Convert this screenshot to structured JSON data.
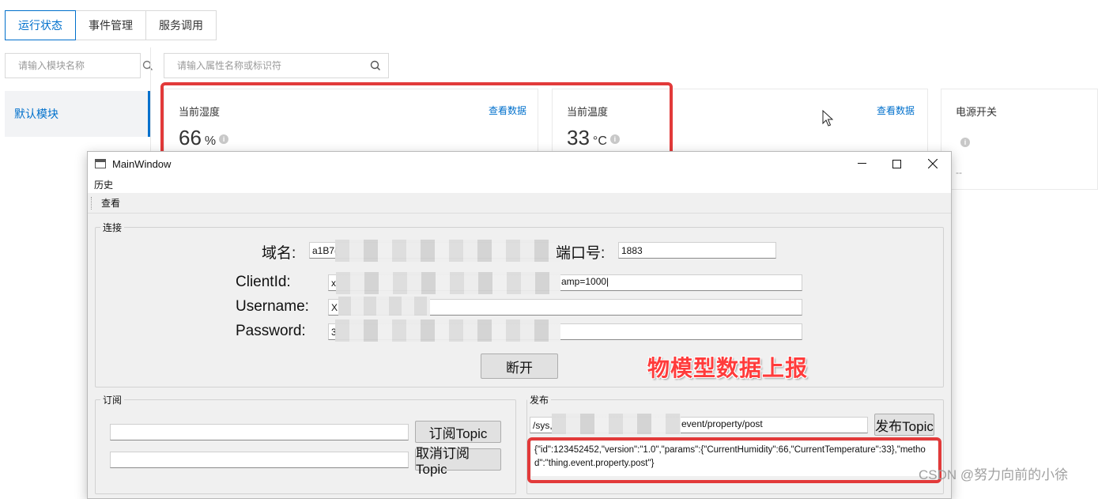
{
  "console": {
    "tabs": [
      {
        "label": "运行状态",
        "active": true
      },
      {
        "label": "事件管理",
        "active": false
      },
      {
        "label": "服务调用",
        "active": false
      }
    ],
    "module_search": {
      "placeholder": "请输入模块名称"
    },
    "property_search": {
      "placeholder": "请输入属性名称或标识符"
    },
    "module_nav": {
      "label": "默认模块"
    },
    "cards": [
      {
        "title": "当前湿度",
        "link": "查看数据",
        "value": "66",
        "unit": "%"
      },
      {
        "title": "当前温度",
        "link": "查看数据",
        "value": "33",
        "unit": "°C"
      },
      {
        "title": "电源开关",
        "value": "--"
      }
    ],
    "accent": "#0070cc",
    "highlight_color": "#e23a3a"
  },
  "window": {
    "title": "MainWindow",
    "menu": [
      "历史"
    ],
    "toolbar": [
      "查看"
    ],
    "connect_group": {
      "label": "连接",
      "domain_label": "域名:",
      "domain_value": "a1B7(",
      "port_label": "端口号:",
      "port_value": "1883",
      "clientid_label": "ClientId:",
      "clientid_value": "x",
      "clientid_tail": "amp=1000|",
      "username_label": "Username:",
      "username_value": "X",
      "password_label": "Password:",
      "password_value": "3",
      "disconnect_button": "断开"
    },
    "subscribe_group": {
      "label": "订阅",
      "subscribe_button": "订阅Topic",
      "unsubscribe_button": "取消订阅Topic"
    },
    "publish_group": {
      "label": "发布",
      "topic_prefix": "/sys,",
      "topic_suffix": "event/property/post",
      "publish_button": "发布Topic",
      "payload": "{\"id\":123452452,\"version\":\"1.0\",\"params\":{\"CurrentHumidity\":66,\"CurrentTemperature\":33},\"method\":\"thing.event.property.post\"}"
    }
  },
  "annotation": "物模型数据上报",
  "watermark": "CSDN @努力向前的小徐",
  "icons": [
    "search-icon",
    "info-icon",
    "cursor-icon",
    "minimize-icon",
    "maximize-icon",
    "close-icon",
    "app-icon"
  ]
}
